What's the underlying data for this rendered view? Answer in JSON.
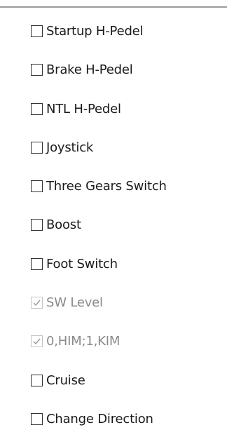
{
  "options": [
    {
      "label": "Startup H-Pedel",
      "checked": false,
      "enabled": true
    },
    {
      "label": "Brake H-Pedel",
      "checked": false,
      "enabled": true
    },
    {
      "label": "NTL H-Pedel",
      "checked": false,
      "enabled": true
    },
    {
      "label": "Joystick",
      "checked": false,
      "enabled": true
    },
    {
      "label": "Three Gears Switch",
      "checked": false,
      "enabled": true
    },
    {
      "label": "Boost",
      "checked": false,
      "enabled": true
    },
    {
      "label": "Foot Switch",
      "checked": false,
      "enabled": true
    },
    {
      "label": "SW Level",
      "checked": true,
      "enabled": false
    },
    {
      "label": "0,HIM;1,KIM",
      "checked": true,
      "enabled": false
    },
    {
      "label": "Cruise",
      "checked": false,
      "enabled": true
    },
    {
      "label": "Change Direction",
      "checked": false,
      "enabled": true
    }
  ],
  "colors": {
    "checkbox_border": "#333333",
    "disabled_border": "#c4c4c4",
    "disabled_check": "#9a9a9a",
    "disabled_text": "#8a8a8a",
    "divider": "#9a9a9a"
  }
}
